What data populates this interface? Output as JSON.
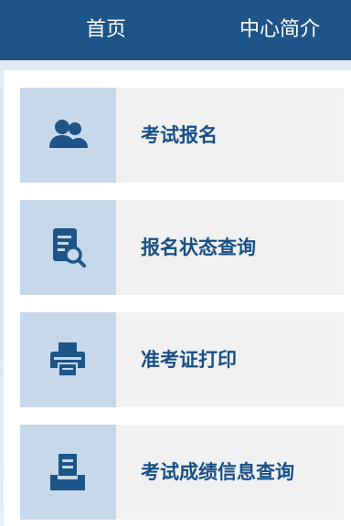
{
  "nav": {
    "home_label": "首页",
    "intro_label": "中心简介"
  },
  "menu": {
    "items": [
      {
        "label": "考试报名",
        "icon": "users-icon"
      },
      {
        "label": "报名状态查询",
        "icon": "document-search-icon"
      },
      {
        "label": "准考证打印",
        "icon": "printer-icon"
      },
      {
        "label": "考试成绩信息查询",
        "icon": "inbox-document-icon"
      }
    ]
  },
  "colors": {
    "nav_background": "#1d5589",
    "accent_text": "#174f86",
    "icon_tile": "#c6d8ea",
    "card_background": "#f1f1f2"
  }
}
